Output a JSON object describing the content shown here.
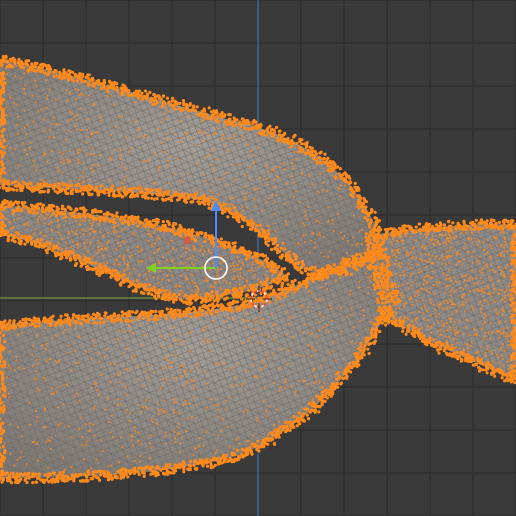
{
  "viewport": {
    "background": "#3a3a3a",
    "grid_minor_color": "#323232",
    "grid_major_color": "#2b2b2b",
    "axis_x_color": "#6e9b3a",
    "axis_z_color": "#3b6fb6"
  },
  "mesh": {
    "surface_color": "#8a8580",
    "wire_color": "#6f6a66",
    "selected_vertex_color": "#ff8a1c",
    "selection_state": "all-selected"
  },
  "gizmo": {
    "type": "move-gizmo",
    "x_axis_color": "#7ed321",
    "z_axis_color": "#4a8cff",
    "center_icon": "circle-outline-icon"
  },
  "cursor_3d": {
    "icon": "3d-cursor-icon",
    "color": "#ffffff",
    "accent_color": "#ff3b30"
  }
}
